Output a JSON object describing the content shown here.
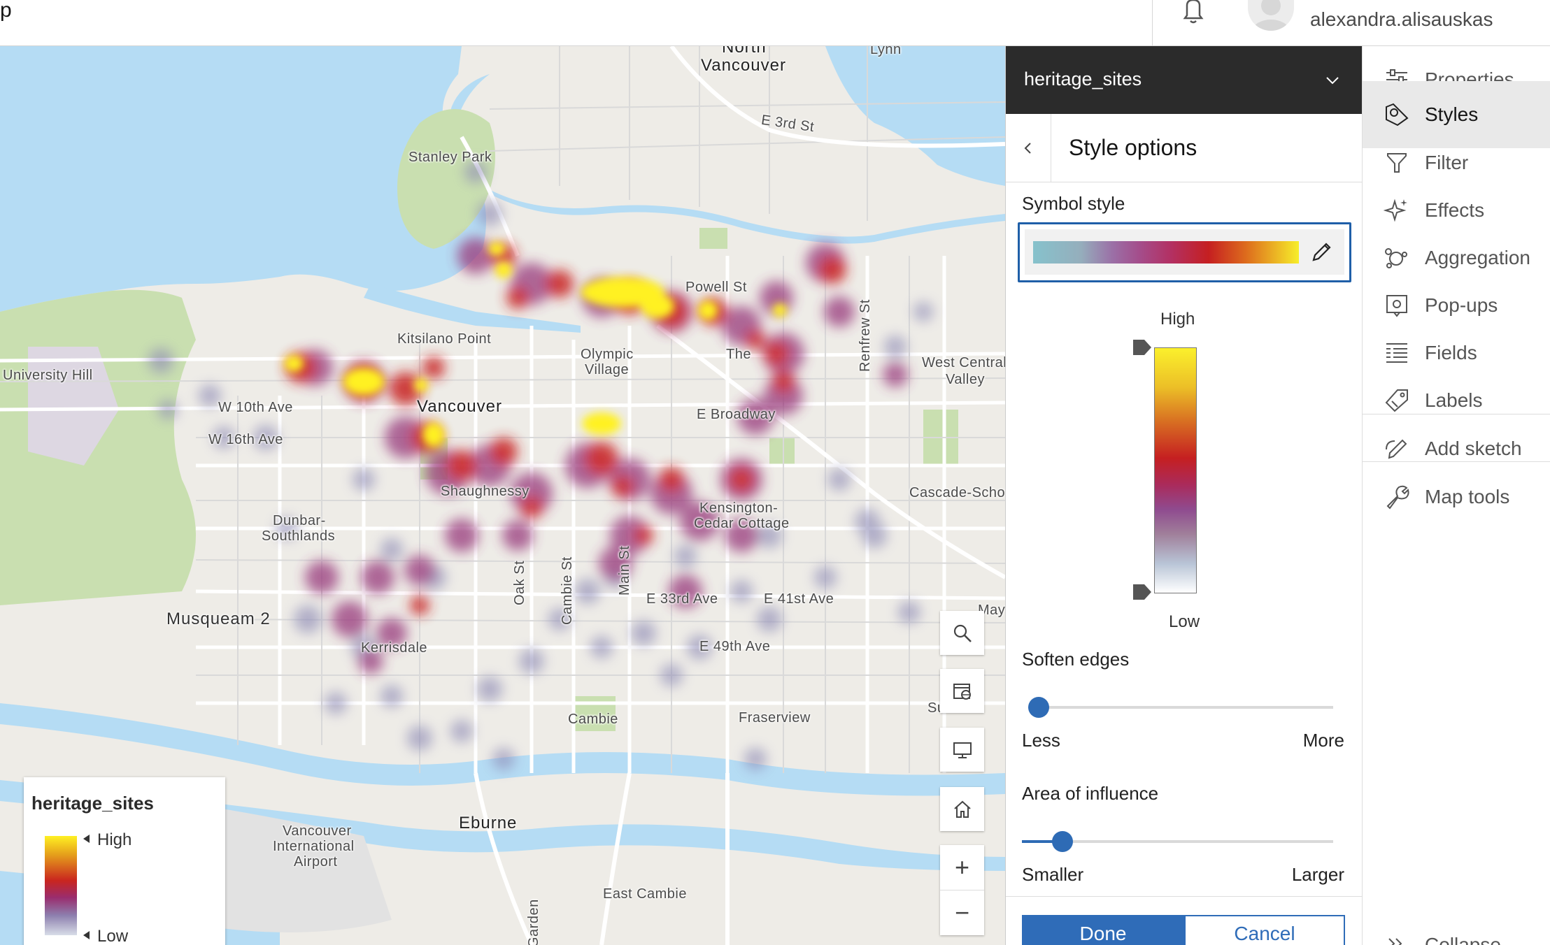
{
  "topbar": {
    "app_fragment": "p",
    "username": "alexandra.alisauskas"
  },
  "map": {
    "labels": {
      "north_vancouver_1": "North",
      "north_vancouver_2": "Vancouver",
      "lynn": "Lynn",
      "e3rd": "E 3rd St",
      "stanley_park": "Stanley Park",
      "kitsilano": "Kitsilano Point",
      "olympic": "Olympic",
      "village": "Village",
      "powell": "Powell St",
      "the_drive": "The",
      "renfrew": "Renfrew St",
      "west_central_1": "West Central",
      "west_central_2": "Valley",
      "university_hill": "University Hill",
      "w10th": "W 10th Ave",
      "w16th": "W 16th Ave",
      "vancouver": "Vancouver",
      "e_broadway": "E Broadway",
      "shaughnessy": "Shaughnessy",
      "cascade": "Cascade-Schou",
      "dunbar_1": "Dunbar-",
      "dunbar_2": "Southlands",
      "kensington_1": "Kensington-",
      "kensington_2": "Cedar Cottage",
      "oak": "Oak St",
      "cambie_st": "Cambie St",
      "main": "Main St",
      "e33rd": "E 33rd Ave",
      "e41st": "E 41st Ave",
      "e49th": "E 49th Ave",
      "musqueam": "Musqueam 2",
      "kerrisdale": "Kerrisdale",
      "cambie": "Cambie",
      "fraserview": "Fraserview",
      "airport_1": "Vancouver",
      "airport_2": "International",
      "airport_3": "Airport",
      "eburne": "Eburne",
      "east_cambie": "East Cambie",
      "garden": "Garden",
      "may": "May",
      "su": "Su"
    },
    "zoom_in": "+",
    "zoom_out": "−"
  },
  "legend": {
    "title": "heritage_sites",
    "high": "High",
    "low": "Low"
  },
  "panel": {
    "layer_name": "heritage_sites",
    "title": "Style options",
    "symbol_style_label": "Symbol style",
    "ramp_high": "High",
    "ramp_low": "Low",
    "soften_edges": {
      "label": "Soften edges",
      "min_label": "Less",
      "max_label": "More",
      "value": 0.02
    },
    "area_of_influence": {
      "label": "Area of influence",
      "min_label": "Smaller",
      "max_label": "Larger",
      "value": 0.1
    },
    "done_label": "Done",
    "cancel_label": "Cancel"
  },
  "nav": {
    "items": [
      {
        "label": "Properties",
        "icon": "sliders-icon"
      },
      {
        "label": "Styles",
        "icon": "styles-icon",
        "active": true
      },
      {
        "label": "Filter",
        "icon": "filter-icon"
      },
      {
        "label": "Effects",
        "icon": "sparkle-icon"
      },
      {
        "label": "Aggregation",
        "icon": "aggregation-icon"
      },
      {
        "label": "Pop-ups",
        "icon": "popup-icon"
      },
      {
        "label": "Fields",
        "icon": "fields-icon"
      },
      {
        "label": "Labels",
        "icon": "label-tag-icon"
      },
      {
        "label": "Add sketch",
        "icon": "sketch-icon"
      },
      {
        "label": "Map tools",
        "icon": "wrench-icon"
      },
      {
        "label": "Collapse",
        "icon": "collapse-icon"
      }
    ]
  },
  "colors": {
    "accent": "#2f6cb8",
    "water": "#b5dcf4",
    "land": "#eeece7",
    "park": "#c9dfb0",
    "header_dark": "#2b2b2b"
  }
}
